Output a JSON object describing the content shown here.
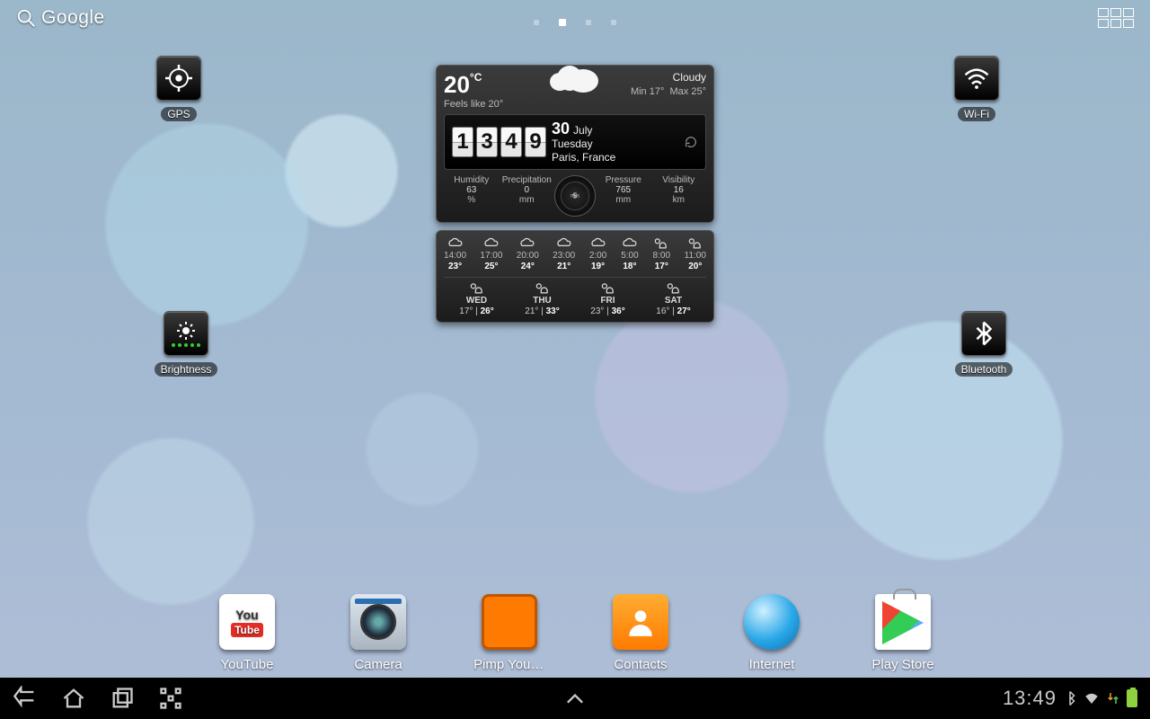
{
  "topbar": {
    "search_label": "Google"
  },
  "toggles": {
    "gps": "GPS",
    "wifi": "Wi-Fi",
    "brightness": "Brightness",
    "bluetooth": "Bluetooth"
  },
  "weather": {
    "temp_value": "20",
    "temp_unit": "°C",
    "condition": "Cloudy",
    "feels_label": "Feels like",
    "feels_value": "20°",
    "min_label": "Min",
    "min_value": "17°",
    "max_label": "Max",
    "max_value": "25°",
    "time_h1": "1",
    "time_h2": "3",
    "time_m1": "4",
    "time_m2": "9",
    "day_num": "30",
    "month": "July",
    "weekday": "Tuesday",
    "city": "Paris, France",
    "wind_value": "5",
    "wind_unit": "m/s",
    "metrics": [
      {
        "label": "Humidity",
        "value": "63",
        "unit": "%"
      },
      {
        "label": "Precipitation",
        "value": "0",
        "unit": "mm"
      },
      {
        "label": "Pressure",
        "value": "765",
        "unit": "mm"
      },
      {
        "label": "Visibility",
        "value": "16",
        "unit": "km"
      }
    ],
    "hourly": [
      {
        "t": "14:00",
        "v": "23°"
      },
      {
        "t": "17:00",
        "v": "25°"
      },
      {
        "t": "20:00",
        "v": "24°"
      },
      {
        "t": "23:00",
        "v": "21°"
      },
      {
        "t": "2:00",
        "v": "19°"
      },
      {
        "t": "5:00",
        "v": "18°"
      },
      {
        "t": "8:00",
        "v": "17°"
      },
      {
        "t": "11:00",
        "v": "20°"
      }
    ],
    "daily": [
      {
        "d": "WED",
        "lo": "17°",
        "hi": "26°"
      },
      {
        "d": "THU",
        "lo": "21°",
        "hi": "33°"
      },
      {
        "d": "FRI",
        "lo": "23°",
        "hi": "36°"
      },
      {
        "d": "SAT",
        "lo": "16°",
        "hi": "27°"
      }
    ]
  },
  "dock": {
    "youtube": "YouTube",
    "camera": "Camera",
    "pimp": "Pimp Your Screen",
    "contacts": "Contacts",
    "internet": "Internet",
    "play": "Play Store"
  },
  "navbar": {
    "clock": "13:49"
  }
}
